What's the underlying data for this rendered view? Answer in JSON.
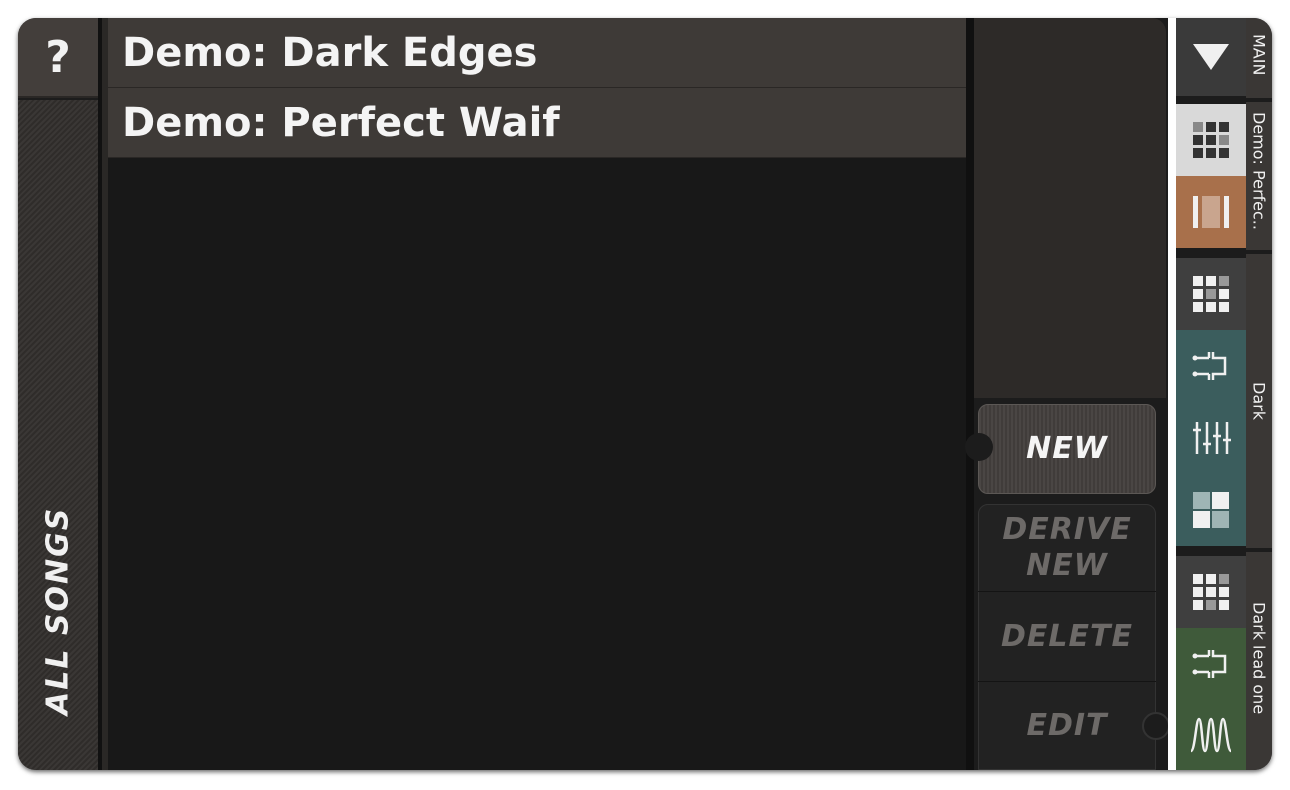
{
  "help_button": {
    "label": "?"
  },
  "sidebar": {
    "all_songs_label": "ALL SONGS"
  },
  "songs": [
    {
      "title": "Demo: Dark Edges"
    },
    {
      "title": "Demo: Perfect Waif"
    }
  ],
  "actions": {
    "new_label": "NEW",
    "derive_line1": "DERIVE",
    "derive_line2": "NEW",
    "delete_label": "DELETE",
    "edit_label": "EDIT"
  },
  "navigator": {
    "main_label": "MAIN",
    "song_label": "Demo: Perfec..",
    "preset_label": "Dark",
    "patch_label": "Dark lead one",
    "colors": {
      "song_grid_bg": "#d9d9d9",
      "song_edit_bg": "#a8704b",
      "dark_grid_bg": "#3f3f3f",
      "dark_teal_bg": "#3b5d5d",
      "patch_grid_bg": "#3f3f3f",
      "patch_green_bg": "#3f5a3a"
    }
  }
}
